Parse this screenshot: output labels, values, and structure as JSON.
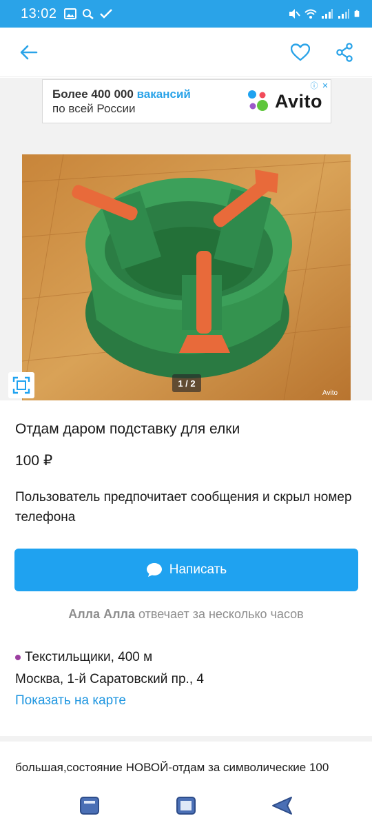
{
  "status_bar": {
    "time": "13:02"
  },
  "app_bar": {
    "back_icon": "arrow-left-icon",
    "favorite_icon": "heart-icon",
    "share_icon": "share-icon"
  },
  "ad": {
    "line1_bold": "Более 400 000",
    "line1_accent": "вакансий",
    "line2": "по всей России",
    "brand": "Avito"
  },
  "gallery": {
    "counter": "1 / 2",
    "watermark": "Avito"
  },
  "listing": {
    "title": "Отдам даром подставку для елки",
    "price": "100 ₽",
    "contact_note": "Пользователь предпочитает сообщения и скрыл номер телефона",
    "write_button": "Написать",
    "seller_name": "Алла Алла",
    "seller_response": "отвечает за несколько часов",
    "metro_station": "Текстильщики, 400 м",
    "address": "Москва, 1-й Саратовский пр., 4",
    "map_link": "Показать на карте",
    "description": "большая,состояние НОВОЙ-отдам за символические 100"
  },
  "colors": {
    "accent": "#2aa3e8",
    "button": "#1fa2f0",
    "link": "#1f96e0",
    "metro_dot": "#9c3fa0"
  }
}
